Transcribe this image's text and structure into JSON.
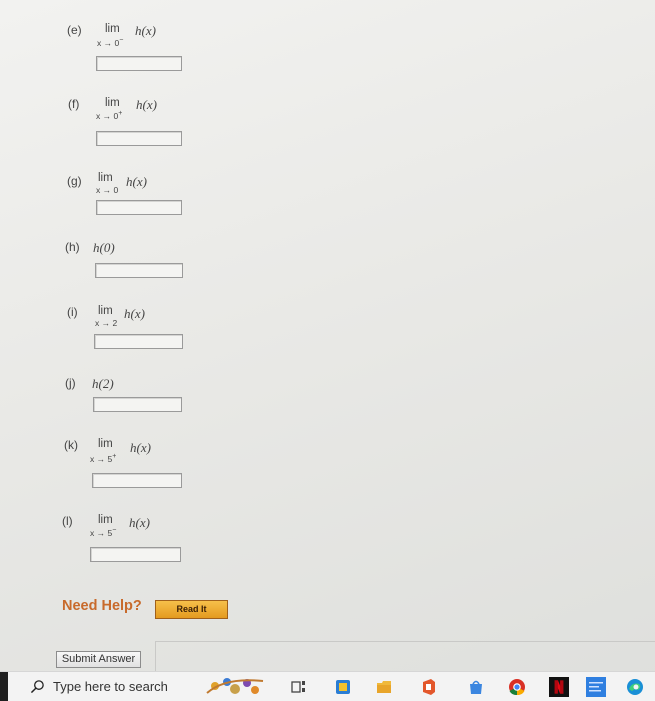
{
  "problems": [
    {
      "label": "(e)",
      "kind": "lim",
      "lim_word": "lim",
      "approach": "x → 0",
      "side": "−",
      "func": "h(x)"
    },
    {
      "label": "(f)",
      "kind": "lim",
      "lim_word": "lim",
      "approach": "x → 0",
      "side": "+",
      "func": "h(x)"
    },
    {
      "label": "(g)",
      "kind": "lim",
      "lim_word": "lim",
      "approach": "x → 0",
      "side": "",
      "func": "h(x)"
    },
    {
      "label": "(h)",
      "kind": "value",
      "func": "h(0)"
    },
    {
      "label": "(i)",
      "kind": "lim",
      "lim_word": "lim",
      "approach": "x → 2",
      "side": "",
      "func": "h(x)"
    },
    {
      "label": "(j)",
      "kind": "value",
      "func": "h(2)"
    },
    {
      "label": "(k)",
      "kind": "lim",
      "lim_word": "lim",
      "approach": "x → 5",
      "side": "+",
      "func": "h(x)"
    },
    {
      "label": "(l)",
      "kind": "lim",
      "lim_word": "lim",
      "approach": "x → 5",
      "side": "−",
      "func": "h(x)"
    }
  ],
  "answers": [
    "",
    "",
    "",
    "",
    "",
    "",
    "",
    ""
  ],
  "help": {
    "label": "Need Help?",
    "read_it": "Read It"
  },
  "submit_label": "Submit Answer",
  "taskbar": {
    "search_placeholder": "Type here to search",
    "icons": [
      "news-widget-icon",
      "task-view-icon",
      "edge-browser-icon",
      "file-explorer-icon",
      "office-icon",
      "store-icon",
      "chrome-icon",
      "netflix-icon",
      "app-tile-icon",
      "edge-icon"
    ]
  },
  "colors": {
    "help_orange": "#c86a2b",
    "read_it_gold": "#e9a52c"
  }
}
